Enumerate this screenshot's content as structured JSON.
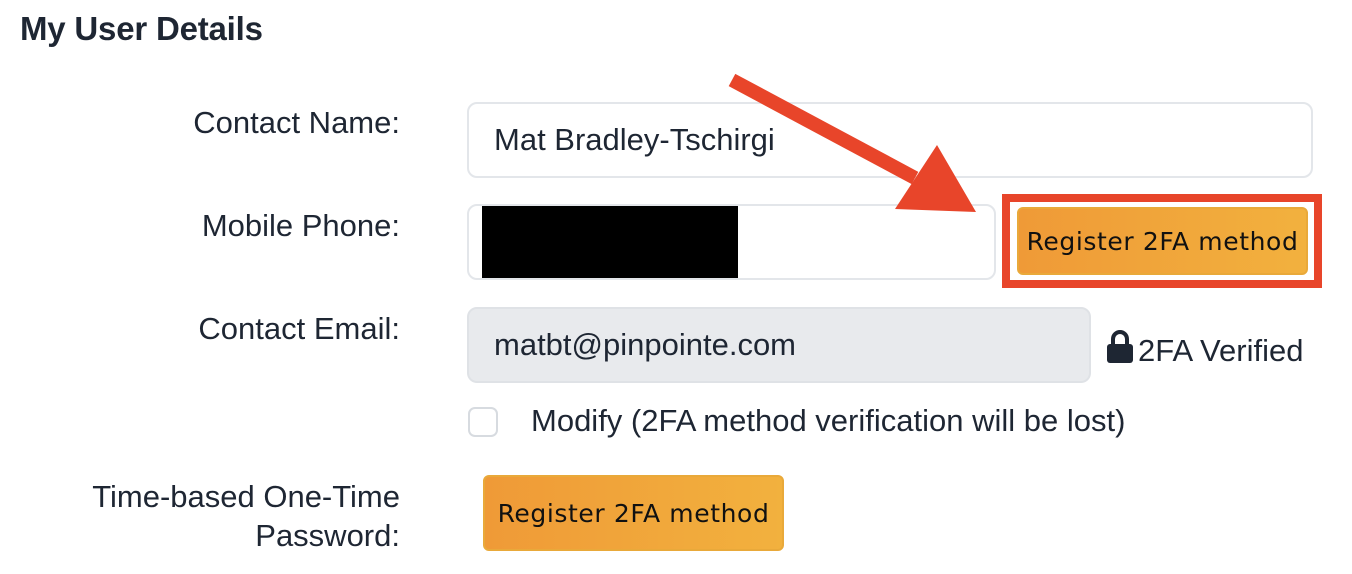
{
  "page": {
    "title": "My User Details"
  },
  "form": {
    "contact_name": {
      "label": "Contact Name:",
      "value": "Mat Bradley-Tschirgi"
    },
    "mobile_phone": {
      "label": "Mobile Phone:",
      "value": "",
      "redacted": true,
      "button_label": "Register 2FA method"
    },
    "contact_email": {
      "label": "Contact Email:",
      "value": "matbt@pinpointe.com",
      "status_icon": "lock-icon",
      "status_text": "2FA Verified"
    },
    "modify": {
      "label": "Modify (2FA method verification will be lost)",
      "checked": false
    },
    "totp": {
      "label_line1": "Time-based One-Time",
      "label_line2": "Password:",
      "button_label": "Register 2FA method"
    }
  },
  "annotation": {
    "arrow_color": "#e8452a",
    "highlight_color": "#e8452a",
    "icon": "arrow-icon"
  },
  "colors": {
    "button_gradient_start": "#ef9a37",
    "button_gradient_end": "#f2b13e",
    "disabled_input_bg": "#e8eaed",
    "text": "#1e2633"
  }
}
